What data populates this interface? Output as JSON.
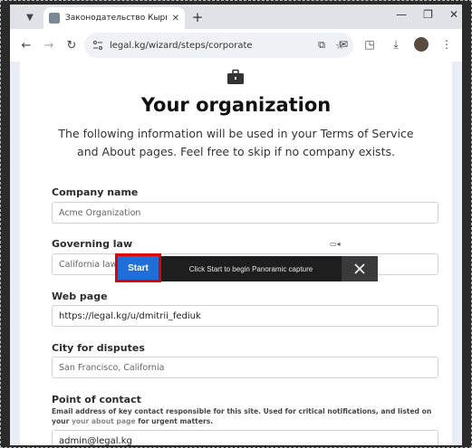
{
  "browser": {
    "tab_title": "Законодательство Кыргызстана",
    "url": "legal.kg/wizard/steps/corporate"
  },
  "page": {
    "title": "Your organization",
    "subtitle": "The following information will be used in your Terms of Service and About pages. Feel free to skip if no company exists."
  },
  "fields": {
    "company_name": {
      "label": "Company name",
      "placeholder": "Acme Organization"
    },
    "governing_law": {
      "label": "Governing law",
      "placeholder": "California law"
    },
    "web_page": {
      "label": "Web page",
      "value": "https://legal.kg/u/dmitrii_fediuk"
    },
    "city": {
      "label": "City for disputes",
      "placeholder": "San Francisco, California"
    },
    "contact": {
      "label": "Point of contact",
      "help_prefix": "Email address of key contact responsible for this site. Used for critical notifications, and listed on your ",
      "help_link": "your about page",
      "help_suffix": " for urgent matters.",
      "value": "admin@legal.kg"
    }
  },
  "panorama": {
    "start_label": "Start",
    "hint": "Click Start to begin Panoramic capture"
  }
}
